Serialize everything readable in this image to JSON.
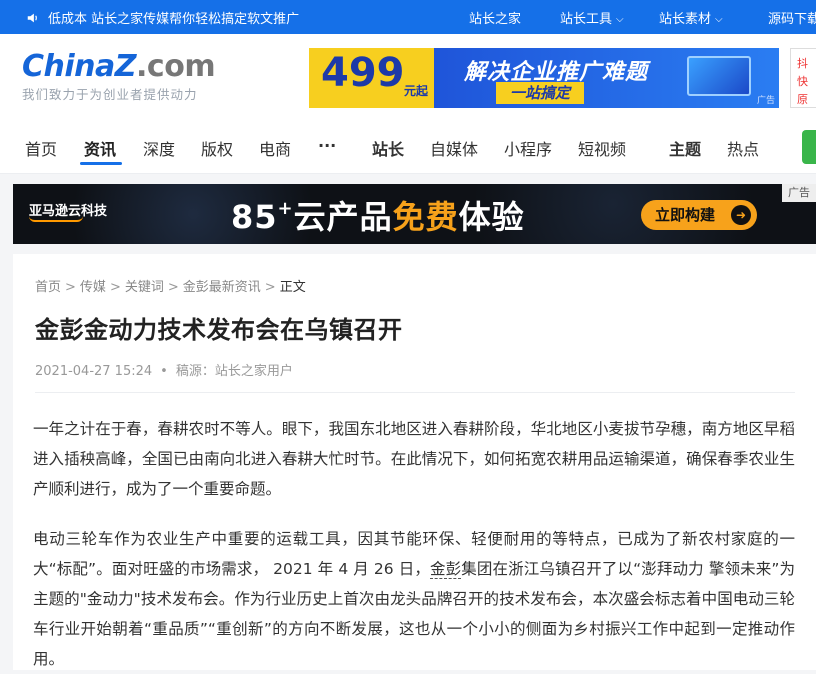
{
  "topbar": {
    "notice": "低成本 站长之家传媒帮你轻松搞定软文推广",
    "links": [
      {
        "label": "站长之家",
        "has_menu": false
      },
      {
        "label": "站长工具",
        "has_menu": true
      },
      {
        "label": "站长素材",
        "has_menu": true
      },
      {
        "label": "源码下载",
        "has_menu": false
      }
    ]
  },
  "header": {
    "logo_brand_a": "China",
    "logo_brand_z": "Z",
    "logo_brand_b": ".com",
    "slogan": "我们致力于为创业者提供动力",
    "banner": {
      "price": "499",
      "price_suffix": "元起",
      "headline": "解决企业推广难题",
      "sub": "一站搞定",
      "ad_tag": "广告"
    },
    "side_mini": [
      "抖",
      "快",
      "原"
    ]
  },
  "nav": {
    "items": [
      "首页",
      "资讯",
      "深度",
      "版权",
      "电商",
      "···",
      "站长",
      "自媒体",
      "小程序",
      "短视频",
      "主题",
      "热点"
    ],
    "active": "资讯"
  },
  "ad_banner": {
    "brand": "亚马逊云科技",
    "headline_num": "85",
    "headline_sup": "+",
    "headline_a": "云产品",
    "headline_hl": "免费",
    "headline_b": "体验",
    "cta": "立即构建",
    "cta_arrow": "➜",
    "ad_label": "广告"
  },
  "article": {
    "breadcrumb": [
      "首页",
      "传媒",
      "关键词",
      "金彭最新资讯",
      "正文"
    ],
    "breadcrumb_sep": ">",
    "title": "金彭金动力技术发布会在乌镇召开",
    "date": "2021-04-27 15:24",
    "meta_dot": "•",
    "source": "稿源：站长之家用户",
    "para1": "一年之计在于春，春耕农时不等人。眼下，我国东北地区进入春耕阶段，华北地区小麦拔节孕穗，南方地区早稻进入插秧高峰，全国已由南向北进入春耕大忙时节。在此情况下，如何拓宽农耕用品运输渠道，确保春季农业生产顺利进行，成为了一个重要命题。",
    "para2_a": "电动三轮车作为农业生产中重要的运载工具，因其节能环保、轻便耐用的等特点，已成为了新农村家庭的一大“标配”。面对旺盛的市场需求， 2021 年 4 月 26 日，",
    "para2_brand": "金彭",
    "para2_b": "集团在浙江乌镇召开了以“澎拜动力 擎领未来”为主题的\"金动力\"技术发布会。作为行业历史上首次由龙头品牌召开的技术发布会，本次盛会标志着中国电动三轮车行业开始朝着“重品质”“重创新”的方向不断发展，这也从一个小小的侧面为乡村振兴工作中起到一定推动作用。"
  },
  "colors": {
    "topbar": "#1570e8",
    "accent": "#1570e8",
    "banner_yellow": "#f7cf1f",
    "ad_orange": "#f7a21b"
  }
}
